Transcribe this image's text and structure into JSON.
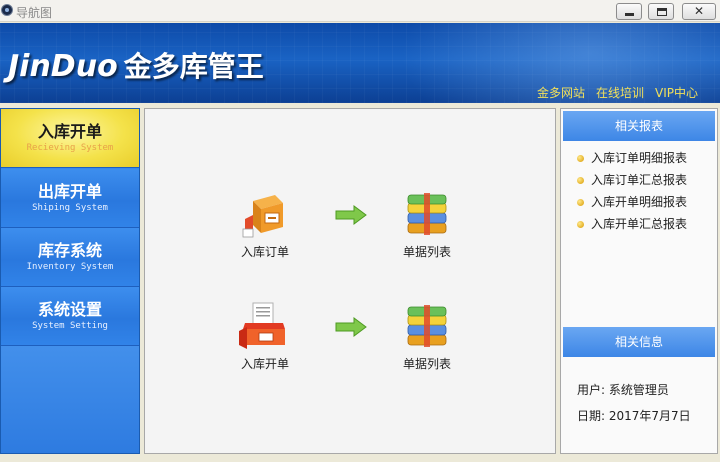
{
  "window": {
    "title": "导航图",
    "minimize_icon": "minimize-icon",
    "maximize_icon": "maximize-icon",
    "close_icon": "close-icon"
  },
  "header": {
    "logo_en": "JinDuo",
    "logo_cn": "金多库管王",
    "links": [
      "金多网站",
      "在线培训",
      "VIP中心"
    ]
  },
  "sidebar": {
    "items": [
      {
        "label": "入库开单",
        "subtitle": "Recieving System",
        "active": true
      },
      {
        "label": "出库开单",
        "subtitle": "Shiping System",
        "active": false
      },
      {
        "label": "库存系统",
        "subtitle": "Inventory System",
        "active": false
      },
      {
        "label": "系统设置",
        "subtitle": "System Setting",
        "active": false
      }
    ]
  },
  "main": {
    "flows": [
      {
        "source": {
          "label": "入库订单",
          "icon": "order-box-icon"
        },
        "arrow": "arrow-right-icon",
        "target": {
          "label": "单据列表",
          "icon": "document-stack-icon"
        }
      },
      {
        "source": {
          "label": "入库开单",
          "icon": "inbound-box-icon"
        },
        "arrow": "arrow-right-icon",
        "target": {
          "label": "单据列表",
          "icon": "document-stack-icon"
        }
      }
    ]
  },
  "right_panel": {
    "reports_title": "相关报表",
    "reports": [
      "入库订单明细报表",
      "入库订单汇总报表",
      "入库开单明细报表",
      "入库开单汇总报表"
    ],
    "info_title": "相关信息",
    "user_label": "用户:",
    "user_value": "系统管理员",
    "date_label": "日期:",
    "date_value": "2017年7月7日"
  },
  "colors": {
    "header_blue": "#1a63c4",
    "link_yellow": "#f2e05a",
    "active_yellow": "#f4e24a",
    "sidebar_blue": "#2b7fe8",
    "panel_head_blue": "#3d86e6"
  }
}
